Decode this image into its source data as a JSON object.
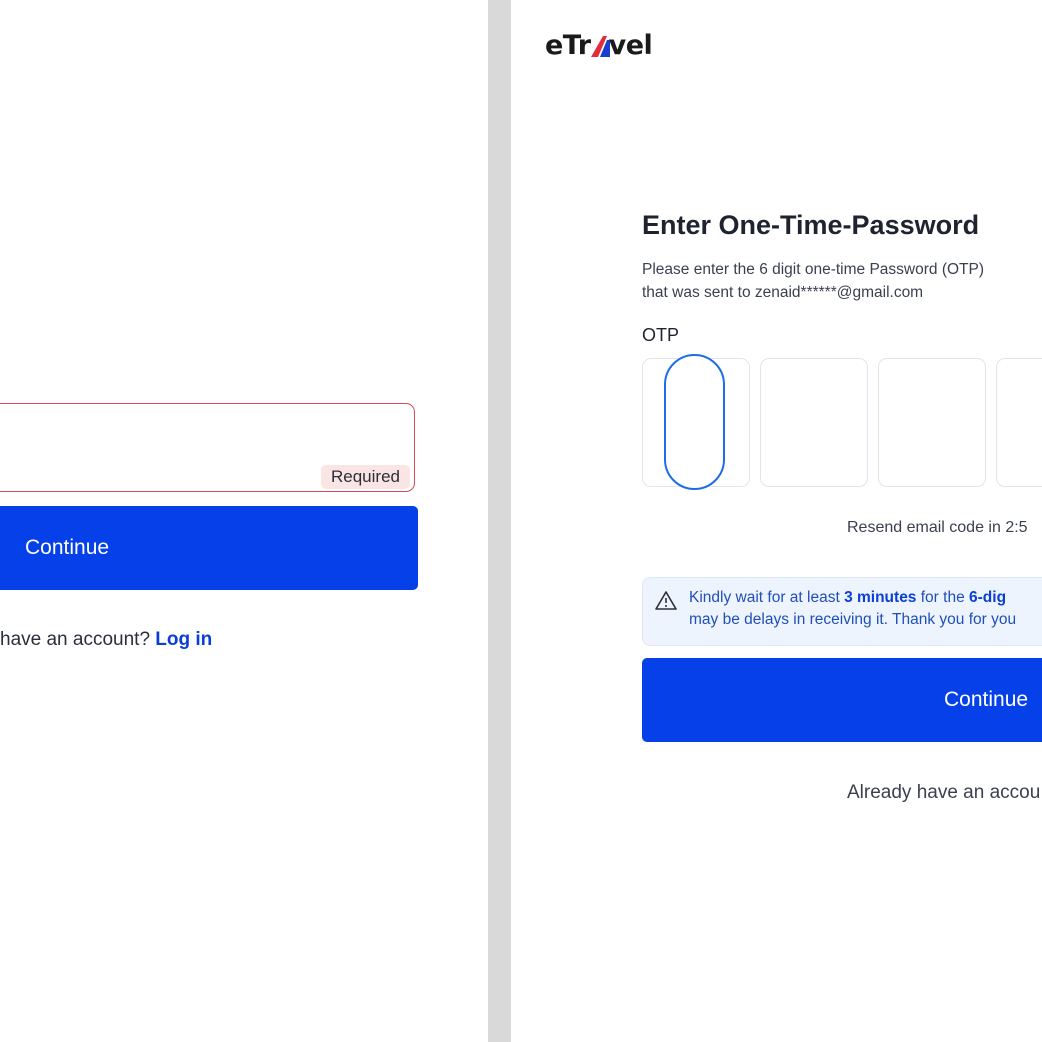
{
  "left": {
    "required_badge": "Required",
    "continue_label": "Continue",
    "account_prompt": "have an account?",
    "login_link": "Log in"
  },
  "right": {
    "logo": {
      "pre": "eTr",
      "post": "vel",
      "mark_colors": [
        "#e22d3c",
        "#1a3fd0"
      ]
    },
    "title": "Enter One-Time-Password",
    "description_line1": "Please enter the 6 digit one-time Password (OTP)",
    "description_line2": "that was sent to zenaid******@gmail.com",
    "otp_label": "OTP",
    "otp_values": [
      "",
      "",
      "",
      ""
    ],
    "resend_text": "Resend email code in 2:5",
    "notice": {
      "icon": "warning-triangle-icon",
      "line1_prefix": "Kindly wait for at least",
      "line1_bold": "3 minutes",
      "line1_middle": "for the",
      "line1_bold2": "6-dig",
      "line2": "may be delays in receiving it. Thank you for you"
    },
    "continue_label": "Continue",
    "account_prompt": "Already have an accou"
  },
  "colors": {
    "primary": "#0640e8",
    "link": "#0a3fd6",
    "error_border": "#d94b55",
    "error_badge_bg": "#fbe4e4",
    "focus_ring": "#1c6de6",
    "notice_bg": "#eef4fd",
    "divider": "#d9d9d9"
  }
}
